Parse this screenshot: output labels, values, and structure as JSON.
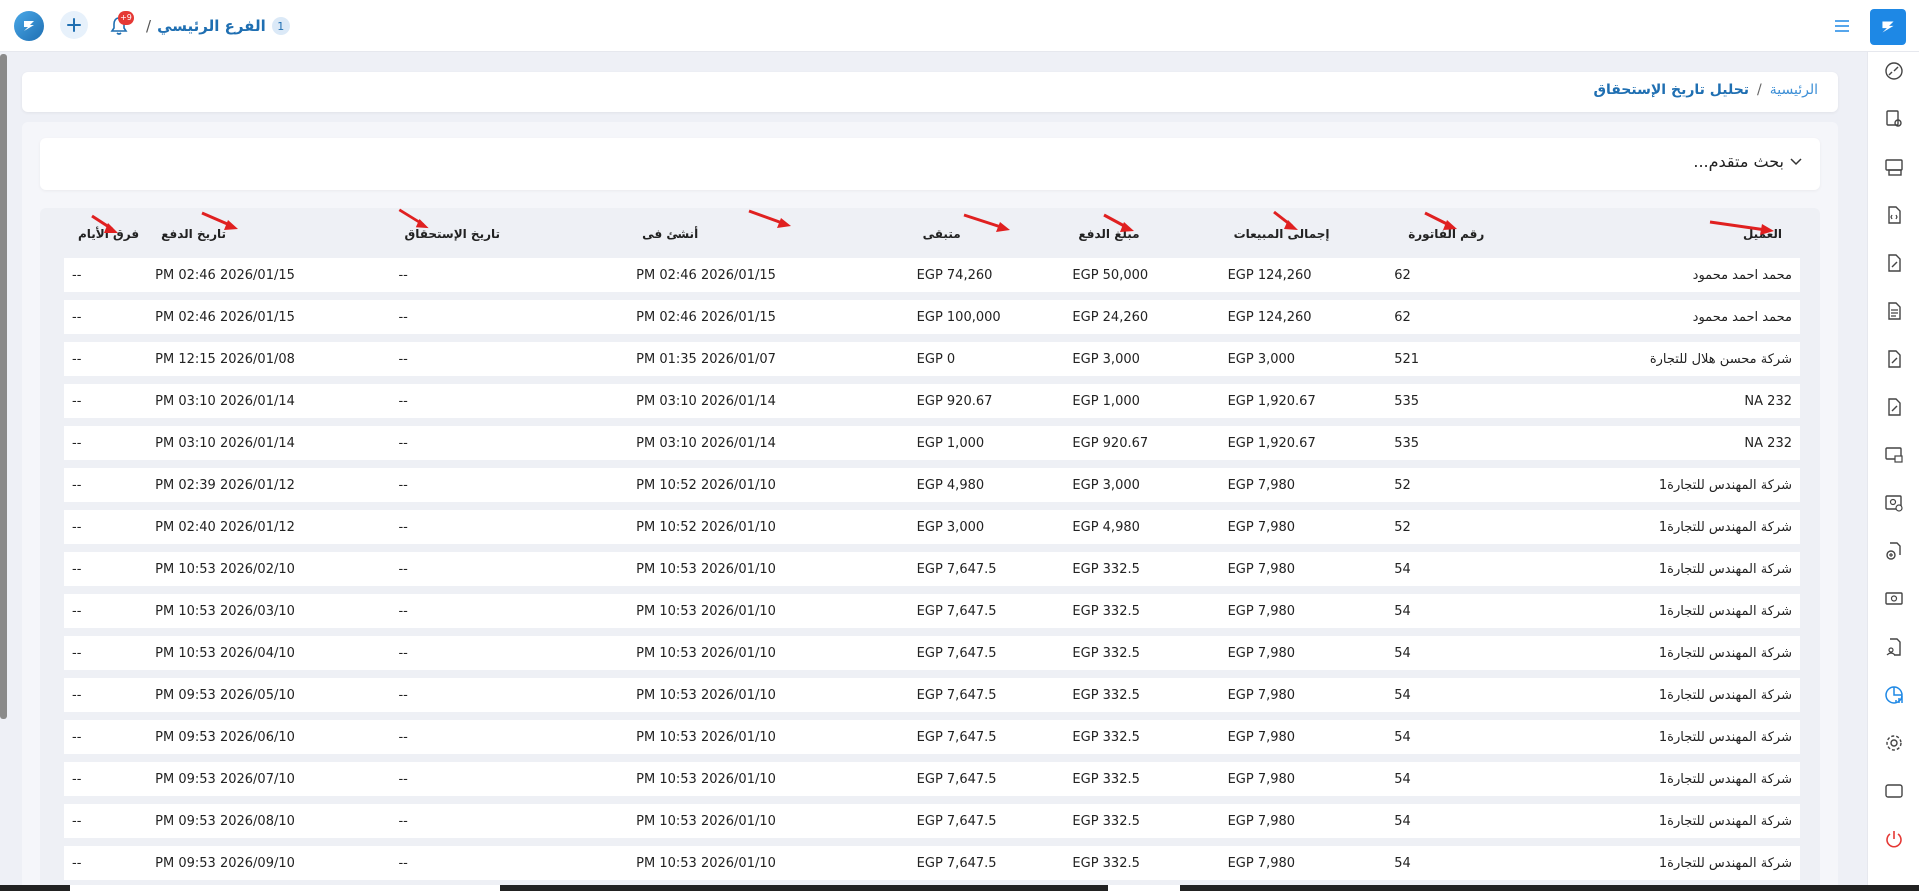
{
  "header": {
    "branch_count": "1",
    "branch_name": "الفرع الرئيسي",
    "branch_sep": "/",
    "notifications_badge": "+9"
  },
  "breadcrumb": {
    "home": "الرئيسية",
    "sep": "/",
    "current": "تحليل تاريخ الإستحقاق"
  },
  "search": {
    "label": "بحث متقدم..."
  },
  "table": {
    "headers": {
      "client": "العميل",
      "invoice": "رقم الفاتورة",
      "sales_total": "إجمالى المبيعات",
      "paid_amount": "مبلغ الدفع",
      "remaining": "متبقى",
      "created_at": "أنشئ فى",
      "due_date": "تاريخ الإستحقاق",
      "pay_date": "تاريخ الدفع",
      "days_diff": "فرق الأيام"
    },
    "rows": [
      {
        "client": "محمد احمد محمود",
        "invoice": "62",
        "sales_total": "EGP 124,260",
        "paid_amount": "EGP 50,000",
        "remaining": "EGP 74,260",
        "created_at": "PM 02:46 2026/01/15",
        "due_date": "--",
        "pay_date": "PM 02:46 2026/01/15",
        "days_diff": "--"
      },
      {
        "client": "محمد احمد محمود",
        "invoice": "62",
        "sales_total": "EGP 124,260",
        "paid_amount": "EGP 24,260",
        "remaining": "EGP 100,000",
        "created_at": "PM 02:46 2026/01/15",
        "due_date": "--",
        "pay_date": "PM 02:46 2026/01/15",
        "days_diff": "--"
      },
      {
        "client": "شركة محسن هلال للتجارة",
        "invoice": "521",
        "sales_total": "EGP 3,000",
        "paid_amount": "EGP 3,000",
        "remaining": "EGP 0",
        "created_at": "PM 01:35 2026/01/07",
        "due_date": "--",
        "pay_date": "PM 12:15 2026/01/08",
        "days_diff": "--"
      },
      {
        "client": "NA 232",
        "invoice": "535",
        "sales_total": "EGP 1,920.67",
        "paid_amount": "EGP 1,000",
        "remaining": "EGP 920.67",
        "created_at": "PM 03:10 2026/01/14",
        "due_date": "--",
        "pay_date": "PM 03:10 2026/01/14",
        "days_diff": "--"
      },
      {
        "client": "NA 232",
        "invoice": "535",
        "sales_total": "EGP 1,920.67",
        "paid_amount": "EGP 920.67",
        "remaining": "EGP 1,000",
        "created_at": "PM 03:10 2026/01/14",
        "due_date": "--",
        "pay_date": "PM 03:10 2026/01/14",
        "days_diff": "--"
      },
      {
        "client": "شركة المهندس للتجارة1",
        "invoice": "52",
        "sales_total": "EGP 7,980",
        "paid_amount": "EGP 3,000",
        "remaining": "EGP 4,980",
        "created_at": "PM 10:52 2026/01/10",
        "due_date": "--",
        "pay_date": "PM 02:39 2026/01/12",
        "days_diff": "--"
      },
      {
        "client": "شركة المهندس للتجارة1",
        "invoice": "52",
        "sales_total": "EGP 7,980",
        "paid_amount": "EGP 4,980",
        "remaining": "EGP 3,000",
        "created_at": "PM 10:52 2026/01/10",
        "due_date": "--",
        "pay_date": "PM 02:40 2026/01/12",
        "days_diff": "--"
      },
      {
        "client": "شركة المهندس للتجارة1",
        "invoice": "54",
        "sales_total": "EGP 7,980",
        "paid_amount": "EGP 332.5",
        "remaining": "EGP 7,647.5",
        "created_at": "PM 10:53 2026/01/10",
        "due_date": "--",
        "pay_date": "PM 10:53 2026/02/10",
        "days_diff": "--"
      },
      {
        "client": "شركة المهندس للتجارة1",
        "invoice": "54",
        "sales_total": "EGP 7,980",
        "paid_amount": "EGP 332.5",
        "remaining": "EGP 7,647.5",
        "created_at": "PM 10:53 2026/01/10",
        "due_date": "--",
        "pay_date": "PM 10:53 2026/03/10",
        "days_diff": "--"
      },
      {
        "client": "شركة المهندس للتجارة1",
        "invoice": "54",
        "sales_total": "EGP 7,980",
        "paid_amount": "EGP 332.5",
        "remaining": "EGP 7,647.5",
        "created_at": "PM 10:53 2026/01/10",
        "due_date": "--",
        "pay_date": "PM 10:53 2026/04/10",
        "days_diff": "--"
      },
      {
        "client": "شركة المهندس للتجارة1",
        "invoice": "54",
        "sales_total": "EGP 7,980",
        "paid_amount": "EGP 332.5",
        "remaining": "EGP 7,647.5",
        "created_at": "PM 10:53 2026/01/10",
        "due_date": "--",
        "pay_date": "PM 09:53 2026/05/10",
        "days_diff": "--"
      },
      {
        "client": "شركة المهندس للتجارة1",
        "invoice": "54",
        "sales_total": "EGP 7,980",
        "paid_amount": "EGP 332.5",
        "remaining": "EGP 7,647.5",
        "created_at": "PM 10:53 2026/01/10",
        "due_date": "--",
        "pay_date": "PM 09:53 2026/06/10",
        "days_diff": "--"
      },
      {
        "client": "شركة المهندس للتجارة1",
        "invoice": "54",
        "sales_total": "EGP 7,980",
        "paid_amount": "EGP 332.5",
        "remaining": "EGP 7,647.5",
        "created_at": "PM 10:53 2026/01/10",
        "due_date": "--",
        "pay_date": "PM 09:53 2026/07/10",
        "days_diff": "--"
      },
      {
        "client": "شركة المهندس للتجارة1",
        "invoice": "54",
        "sales_total": "EGP 7,980",
        "paid_amount": "EGP 332.5",
        "remaining": "EGP 7,647.5",
        "created_at": "PM 10:53 2026/01/10",
        "due_date": "--",
        "pay_date": "PM 09:53 2026/08/10",
        "days_diff": "--"
      },
      {
        "client": "شركة المهندس للتجارة1",
        "invoice": "54",
        "sales_total": "EGP 7,980",
        "paid_amount": "EGP 332.5",
        "remaining": "EGP 7,647.5",
        "created_at": "PM 10:53 2026/01/10",
        "due_date": "--",
        "pay_date": "PM 09:53 2026/09/10",
        "days_diff": "--"
      }
    ]
  },
  "sidebar": {
    "items": [
      {
        "icon": "speedometer-icon"
      },
      {
        "icon": "invoice-user-icon"
      },
      {
        "icon": "register-icon"
      },
      {
        "icon": "code-file-icon"
      },
      {
        "icon": "edit-file-icon"
      },
      {
        "icon": "document-icon"
      },
      {
        "icon": "edit-file-icon"
      },
      {
        "icon": "edit-file-icon"
      },
      {
        "icon": "monitor-card-icon"
      },
      {
        "icon": "user-settings-icon"
      },
      {
        "icon": "add-document-icon"
      },
      {
        "icon": "cash-icon"
      },
      {
        "icon": "file-user-icon"
      },
      {
        "icon": "analytics-icon"
      },
      {
        "icon": "gear-icon"
      },
      {
        "icon": "window-icon"
      },
      {
        "icon": "power-icon"
      }
    ]
  },
  "colors": {
    "accent": "#1f6fb2",
    "annotation_arrow": "#e02020",
    "logout": "#e53935"
  }
}
